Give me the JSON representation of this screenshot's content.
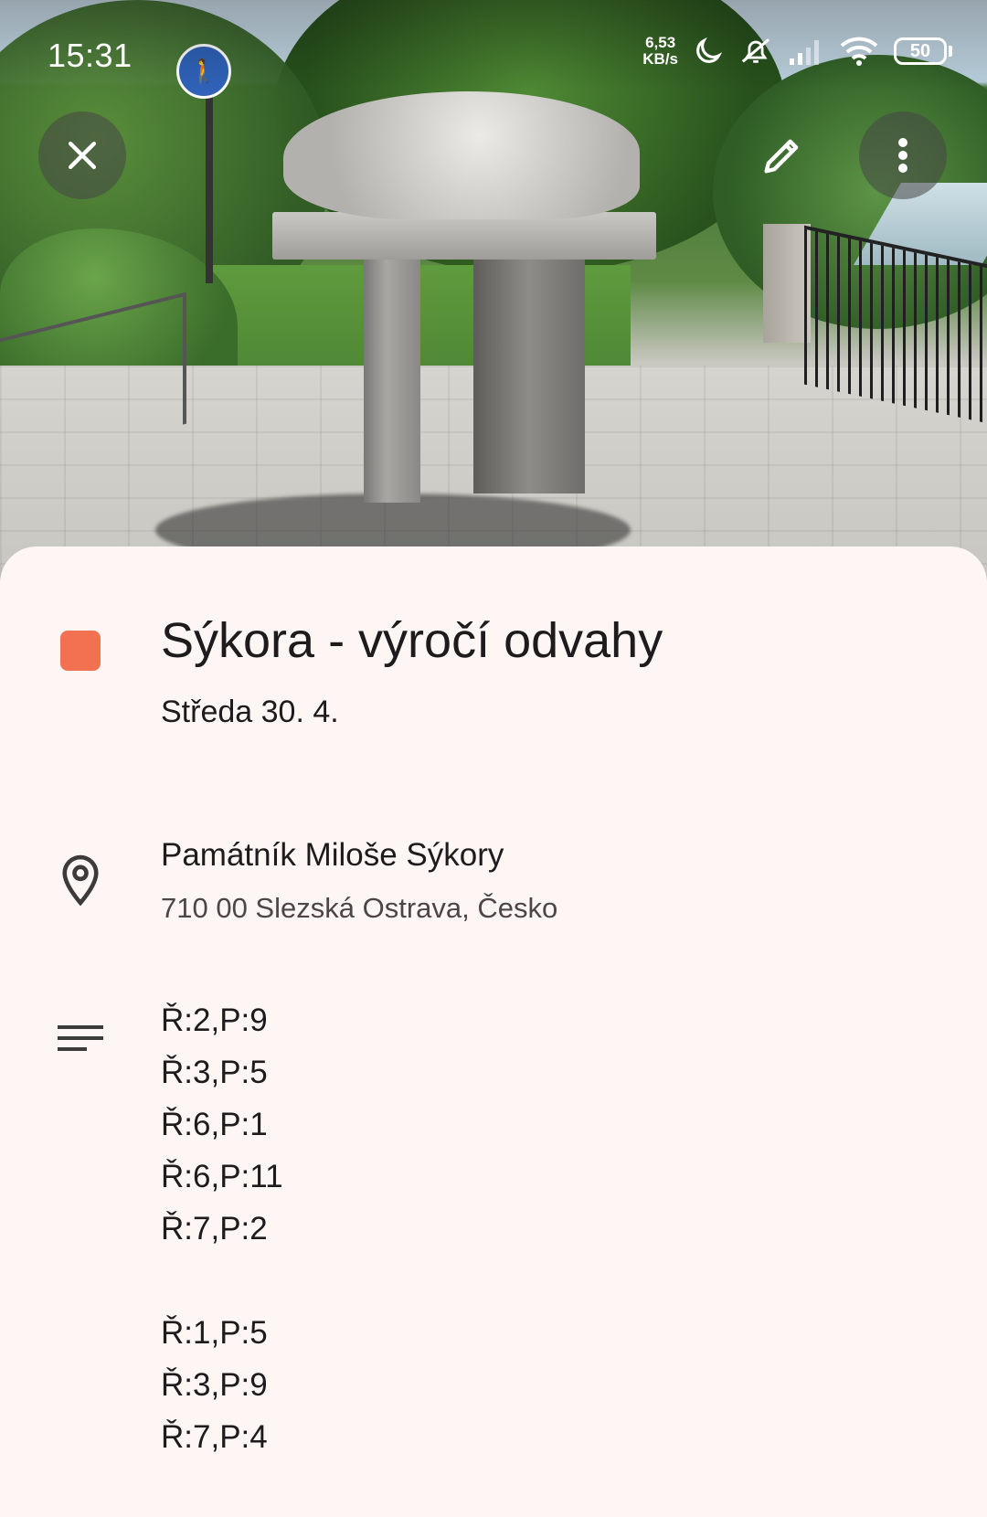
{
  "status_bar": {
    "time": "15:31",
    "net_speed_value": "6,53",
    "net_speed_unit": "KB/s",
    "battery": "50",
    "icons": [
      "moon-icon",
      "silent-bell-icon",
      "signal-icon",
      "wifi-icon",
      "battery-icon"
    ]
  },
  "toolbar": {
    "close_icon": "close-icon",
    "edit_icon": "pencil-icon",
    "more_icon": "more-vert-icon"
  },
  "event": {
    "color": "#f27150",
    "title": "Sýkora - výročí odvahy",
    "date": "Středa 30. 4.",
    "location_name": "Památník Miloše Sýkory",
    "location_address": "710 00 Slezská Ostrava, Česko",
    "description_group_1": [
      "Ř:2,P:9",
      "Ř:3,P:5",
      "Ř:6,P:1",
      "Ř:6,P:11",
      "Ř:7,P:2"
    ],
    "description_group_2": [
      "Ř:1,P:5",
      "Ř:3,P:9",
      "Ř:7,P:4"
    ]
  }
}
